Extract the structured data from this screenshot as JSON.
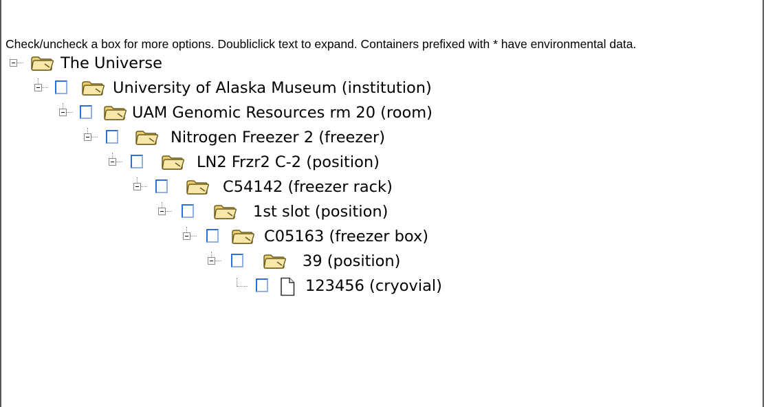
{
  "help_text": "Check/uncheck a box for more options. Doubliclick text to expand. Containers prefixed with * have environmental data.",
  "tree": {
    "root": {
      "label": "The Universe",
      "icon": "folder-icon"
    },
    "nodes": [
      {
        "label": "University of Alaska Museum (institution)",
        "icon": "folder-icon",
        "checked": false
      },
      {
        "label": "UAM Genomic Resources rm 20 (room)",
        "icon": "folder-icon",
        "checked": false
      },
      {
        "label": "Nitrogen Freezer 2 (freezer)",
        "icon": "folder-icon",
        "checked": false
      },
      {
        "label": "LN2 Frzr2 C-2 (position)",
        "icon": "folder-icon",
        "checked": false
      },
      {
        "label": "C54142 (freezer rack)",
        "icon": "folder-icon",
        "checked": false
      },
      {
        "label": "1st slot (position)",
        "icon": "folder-icon",
        "checked": false
      },
      {
        "label": "C05163 (freezer box)",
        "icon": "folder-icon",
        "checked": false
      },
      {
        "label": "39 (position)",
        "icon": "folder-icon",
        "checked": false
      },
      {
        "label": "123456 (cryovial)",
        "icon": "file-icon",
        "checked": false
      }
    ]
  },
  "colors": {
    "checkbox_border": "#2b6fd6",
    "folder_fill": "#f3dc8c",
    "folder_stroke": "#6b5a1c"
  }
}
